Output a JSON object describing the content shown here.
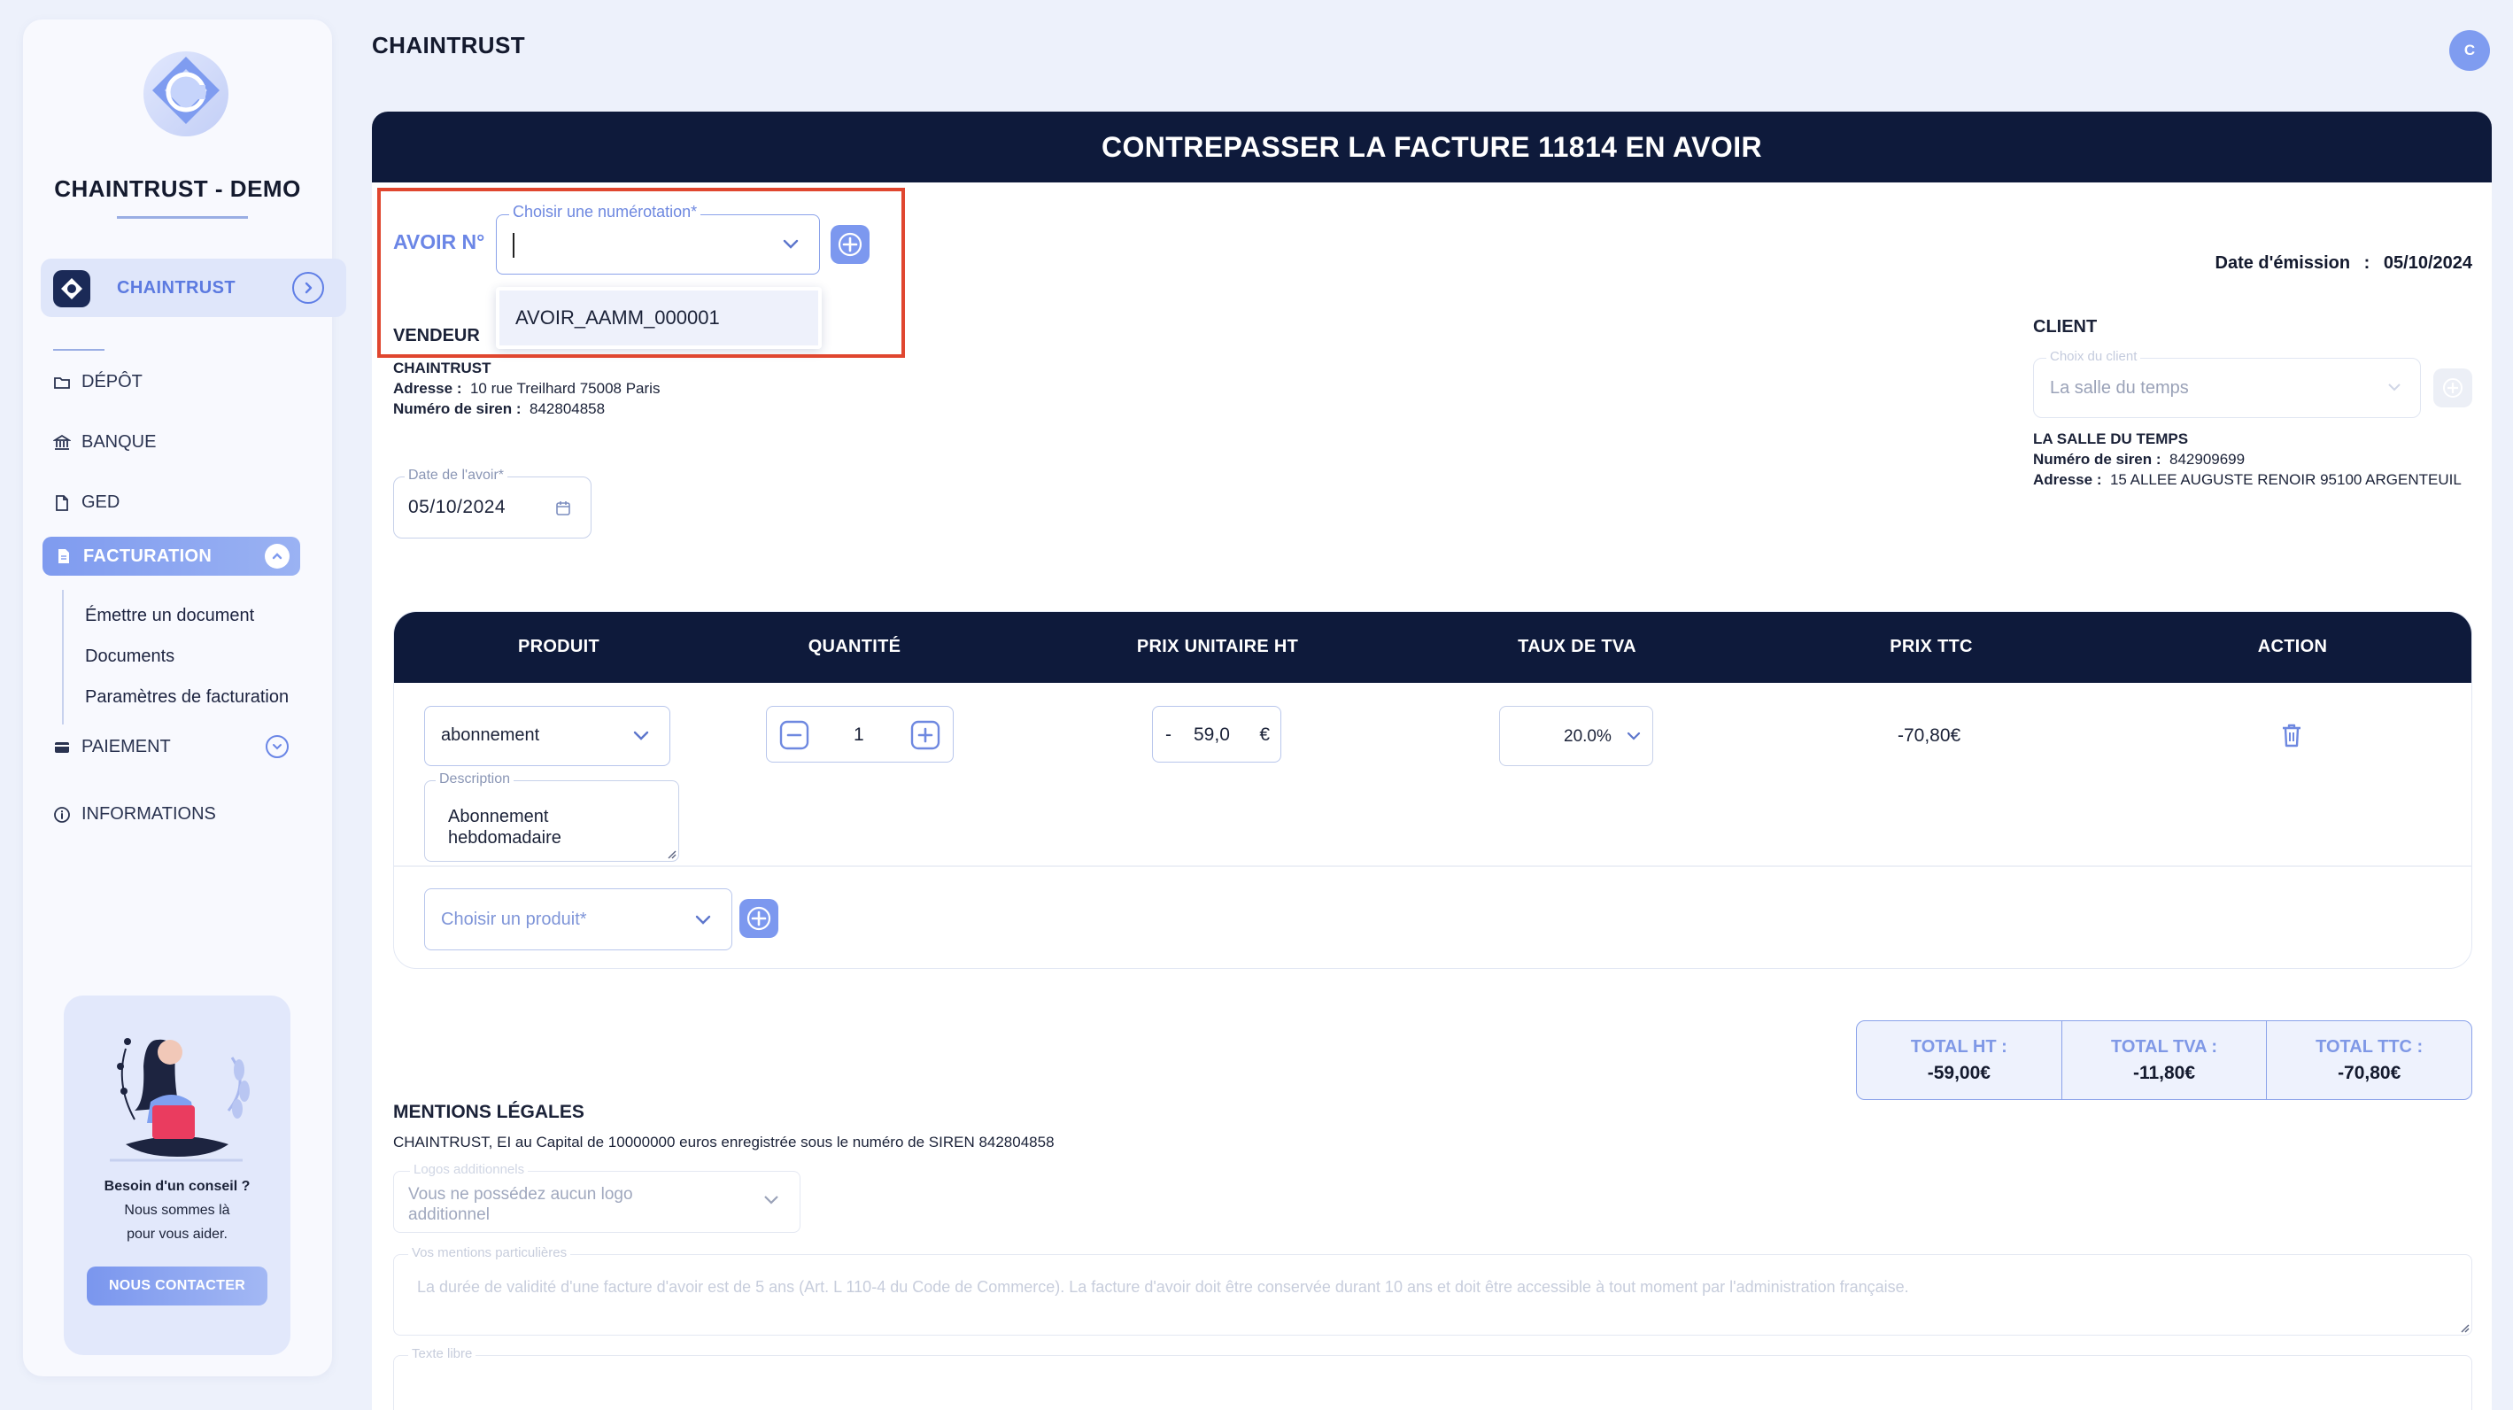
{
  "sidebar": {
    "brand": "CHAINTRUST - DEMO",
    "company": "CHAINTRUST",
    "nav": [
      {
        "label": "DÉPÔT",
        "icon": "folder-icon"
      },
      {
        "label": "BANQUE",
        "icon": "bank-icon"
      },
      {
        "label": "GED",
        "icon": "document-icon"
      },
      {
        "label": "FACTURATION",
        "icon": "invoice-icon"
      },
      {
        "label": "PAIEMENT",
        "icon": "card-icon"
      },
      {
        "label": "INFORMATIONS",
        "icon": "info-icon"
      }
    ],
    "sub_items": [
      "Émettre un document",
      "Documents",
      "Paramètres de facturation"
    ],
    "help": {
      "line1": "Besoin d'un conseil ?",
      "line2": "Nous sommes là",
      "line3": "pour vous aider.",
      "button": "NOUS CONTACTER"
    }
  },
  "header": {
    "title": "CHAINTRUST",
    "avatar": "C"
  },
  "form": {
    "title": "CONTREPASSER LA FACTURE 11814 EN AVOIR",
    "avoir_label": "AVOIR N°",
    "numerotation": {
      "legend": "Choisir une numérotation*",
      "value": "",
      "options": [
        "AVOIR_AAMM_000001"
      ]
    },
    "emission_label": "Date d'émission",
    "emission_sep": ":",
    "emission_date": "05/10/2024",
    "vendeur": {
      "title": "VENDEUR",
      "name": "CHAINTRUST",
      "address_label": "Adresse :",
      "address": "10 rue Treilhard 75008 Paris",
      "siren_label": "Numéro de siren :",
      "siren": "842804858"
    },
    "date_avoir": {
      "legend": "Date de l'avoir*",
      "value": "05/10/2024"
    },
    "client": {
      "title": "CLIENT",
      "legend": "Choix du client",
      "value": "La salle du temps",
      "name": "LA SALLE DU TEMPS",
      "siren_label": "Numéro de siren :",
      "siren": "842909699",
      "address_label": "Adresse :",
      "address": "15 ALLEE AUGUSTE RENOIR 95100 ARGENTEUIL"
    }
  },
  "table": {
    "headers": [
      "PRODUIT",
      "QUANTITÉ",
      "PRIX UNITAIRE HT",
      "TAUX DE TVA",
      "PRIX TTC",
      "ACTION"
    ],
    "row": {
      "product": "abonnement",
      "quantity": "1",
      "price_sign": "-",
      "price": "59,0",
      "currency": "€",
      "vat": "20.0%",
      "total_ttc": "-70,80€",
      "description_legend": "Description",
      "description": "Abonnement hebdomadaire"
    },
    "add_product_placeholder": "Choisir un produit*"
  },
  "totals": [
    {
      "label": "TOTAL HT :",
      "value": "-59,00€"
    },
    {
      "label": "TOTAL TVA :",
      "value": "-11,80€"
    },
    {
      "label": "TOTAL TTC :",
      "value": "-70,80€"
    }
  ],
  "mentions": {
    "title": "MENTIONS LÉGALES",
    "text": "CHAINTRUST, EI au Capital de 10000000 euros enregistrée sous le numéro de SIREN 842804858",
    "logos_legend": "Logos additionnels",
    "logos_value": "Vous ne possédez aucun logo additionnel",
    "particulieres_legend": "Vos mentions particulières",
    "particulieres_value": "La durée de validité d'une facture d'avoir est de 5 ans (Art. L 110-4 du Code de Commerce). La facture d'avoir doit être conservée durant 10 ans et doit être accessible à tout moment par l'administration française.",
    "texte_libre_legend": "Texte libre"
  },
  "colors": {
    "navy": "#0e1a3b",
    "accent": "#7c98ef",
    "highlight": "#e0462f",
    "background": "#edf1fb"
  }
}
